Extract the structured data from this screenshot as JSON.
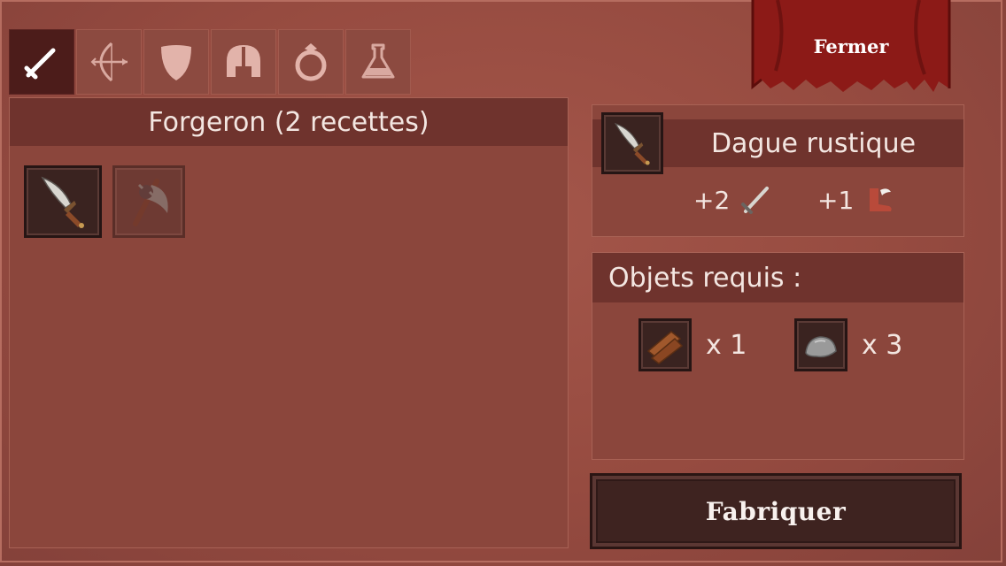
{
  "tabs": [
    {
      "icon": "sword-icon",
      "active": true
    },
    {
      "icon": "bow-icon",
      "active": false
    },
    {
      "icon": "shield-icon",
      "active": false
    },
    {
      "icon": "helmet-icon",
      "active": false
    },
    {
      "icon": "ring-icon",
      "active": false
    },
    {
      "icon": "potion-icon",
      "active": false
    }
  ],
  "left_panel": {
    "title": "Forgeron (2 recettes)",
    "recipes": [
      {
        "icon": "dagger-icon",
        "available": true
      },
      {
        "icon": "axe-icon",
        "available": false
      }
    ]
  },
  "close_button": {
    "label": "Fermer"
  },
  "selected_item": {
    "name": "Dague rustique",
    "icon": "dagger-icon",
    "stats": [
      {
        "value": "+2",
        "icon": "attack-sword-icon"
      },
      {
        "value": "+1",
        "icon": "speed-boot-icon"
      }
    ]
  },
  "required": {
    "title": "Objets requis :",
    "items": [
      {
        "icon": "wood-icon",
        "quantity": "x 1"
      },
      {
        "icon": "stone-icon",
        "quantity": "x 3"
      }
    ]
  },
  "craft_button": {
    "label": "Fabriquer"
  },
  "colors": {
    "background": "#964b40",
    "panel_header": "#6f332d",
    "active_tab": "#4c1c1a",
    "banner": "#8c1a17"
  }
}
